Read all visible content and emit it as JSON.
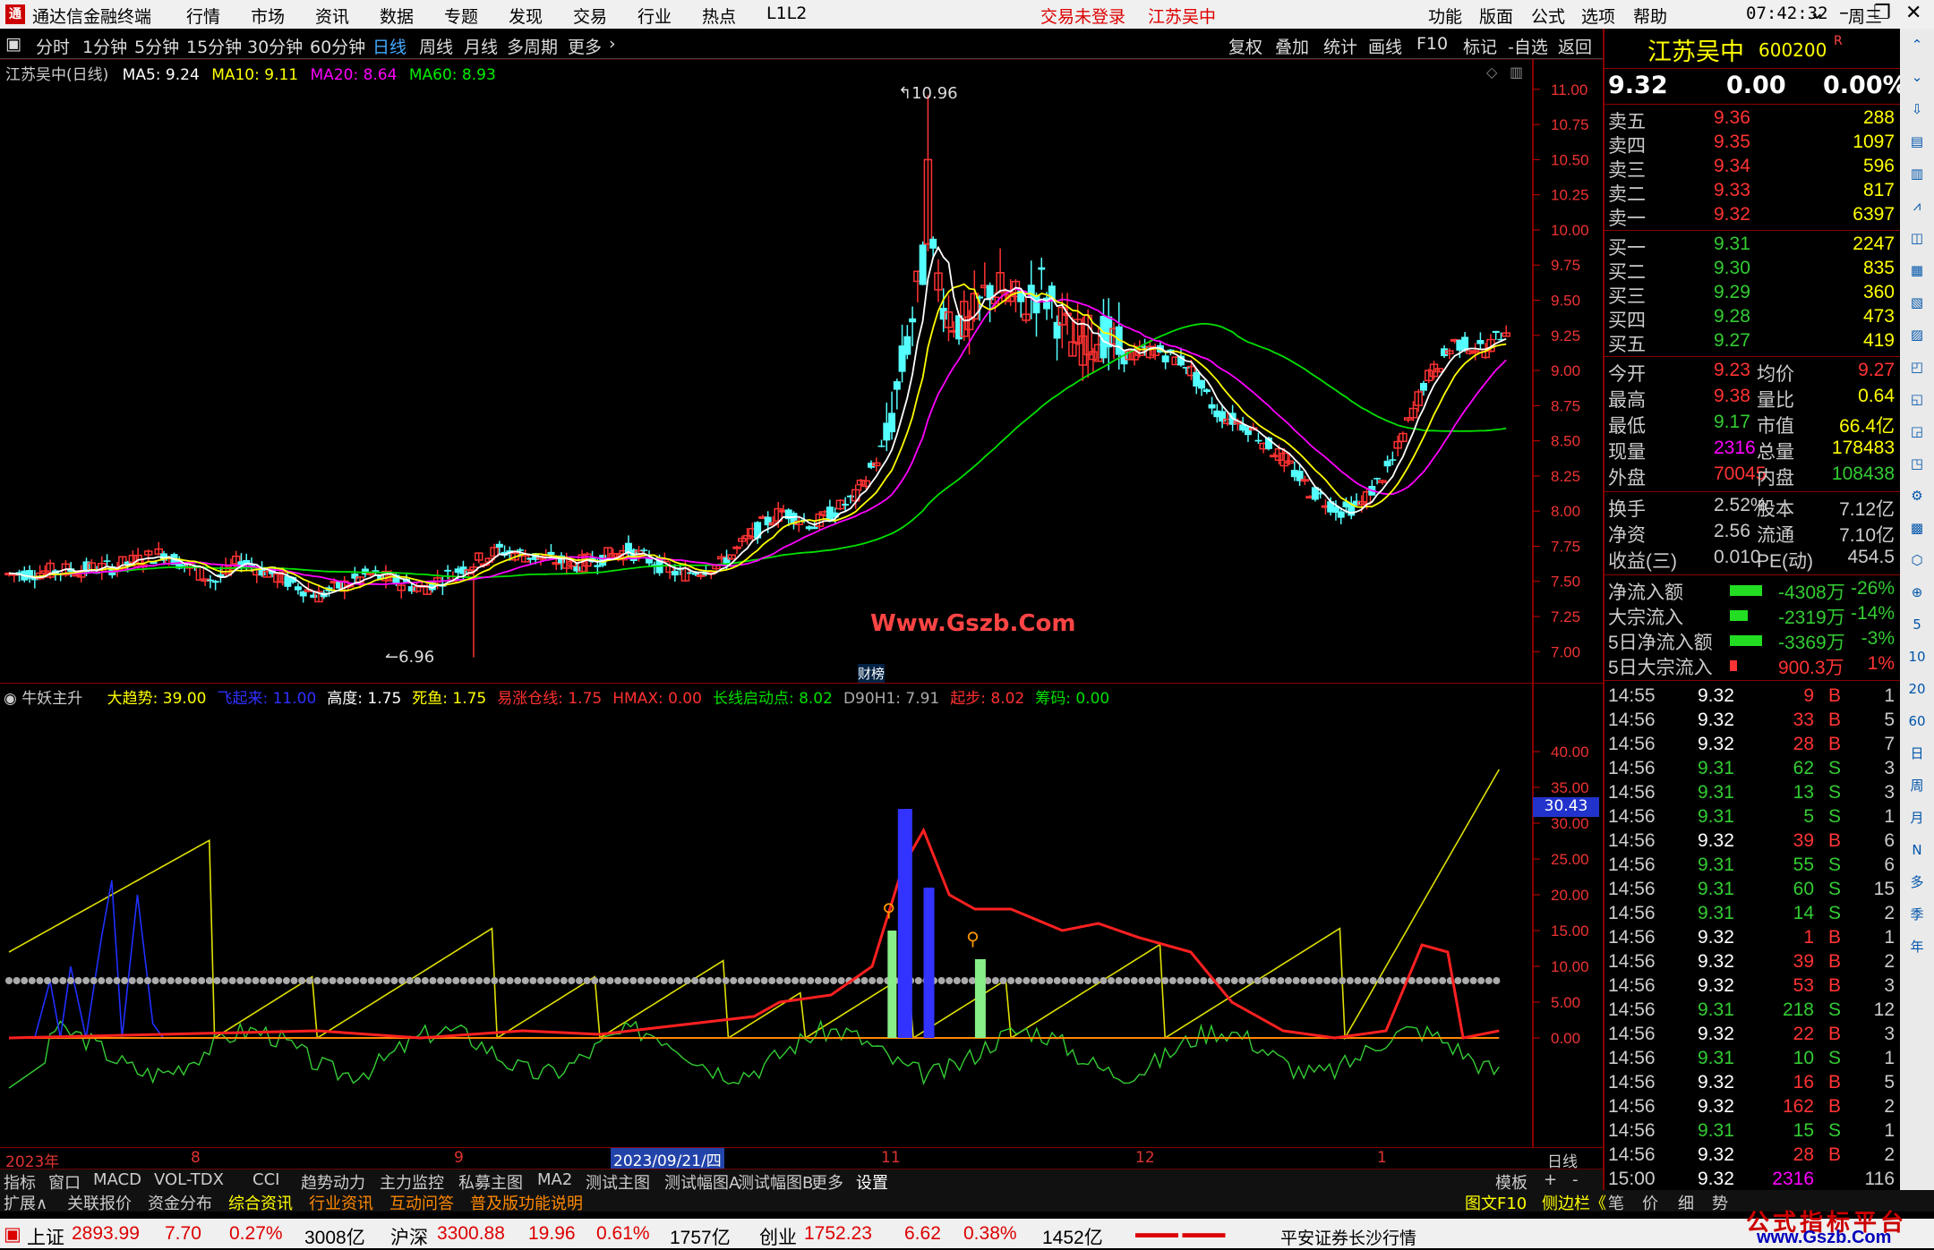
{
  "titlebar": {
    "logo": "通",
    "title": "通达信金融终端",
    "menus": [
      "行情",
      "市场",
      "资讯",
      "数据",
      "专题",
      "发现",
      "交易",
      "行业",
      "热点",
      "L1L2"
    ],
    "warn1": "交易未登录",
    "warn2": "江苏吴中",
    "rmenus": [
      "功能",
      "版面",
      "公式",
      "选项",
      "帮助"
    ],
    "time": "07:42:32",
    "weekday": "周三"
  },
  "toolbar": {
    "periods": [
      "分时",
      "1分钟",
      "5分钟",
      "15分钟",
      "30分钟",
      "60分钟",
      "日线",
      "周线",
      "月线",
      "多周期",
      "更多"
    ],
    "active": "日线",
    "actions": [
      "复权",
      "叠加",
      "统计",
      "画线",
      "F10",
      "标记",
      "-自选",
      "返回"
    ]
  },
  "main": {
    "legend_name": "江苏吴中(日线)",
    "ma5": "MA5: 9.24",
    "ma10": "MA10: 9.11",
    "ma20": "MA20: 8.64",
    "ma60": "MA60: 8.93",
    "high_label": "10.96",
    "low_label": "6.96",
    "watermark": "Www.Gszb.Com",
    "event": "财榜",
    "yticks": [
      "11.00",
      "10.75",
      "10.50",
      "10.25",
      "10.00",
      "9.75",
      "9.50",
      "9.25",
      "9.00",
      "8.75",
      "8.50",
      "8.25",
      "8.00",
      "7.75",
      "7.50",
      "7.25",
      "7.00"
    ],
    "colors": {
      "up": "#ff3232",
      "down": "#54ffff",
      "ma5": "#ffffff",
      "ma10": "#ffff00",
      "ma20": "#ff00ff",
      "ma60": "#00e000"
    }
  },
  "sub": {
    "name": "牛妖主升",
    "items": [
      {
        "label": "大趋势: 39.00",
        "color": "#ffff00"
      },
      {
        "label": "飞起来: 11.00",
        "color": "#3030ff"
      },
      {
        "label": "高度: 1.75",
        "color": "#ffffff"
      },
      {
        "label": "死鱼: 1.75",
        "color": "#ffff00"
      },
      {
        "label": "易涨仓线: 1.75",
        "color": "#ff3030"
      },
      {
        "label": "HMAX: 0.00",
        "color": "#ff3030"
      },
      {
        "label": "长线启动点: 8.02",
        "color": "#00e000"
      },
      {
        "label": "D90H1: 7.91",
        "color": "#aaaaaa"
      },
      {
        "label": "起步: 8.02",
        "color": "#ff3030"
      },
      {
        "label": "筹码: 0.00",
        "color": "#00e000"
      }
    ],
    "yticks": [
      "40.00",
      "35.00",
      "30.00",
      "25.00",
      "20.00",
      "15.00",
      "10.00",
      "5.00",
      "0.00"
    ],
    "cursor_value": "30.43",
    "xlabels": [
      "2023年",
      "8",
      "9",
      "2023/09/21/四",
      "11",
      "12",
      "1"
    ],
    "period_label": "日线"
  },
  "chart_data": [
    {
      "type": "line",
      "title": "江苏吴中(日线)",
      "ylim": [
        6.9,
        11.05
      ],
      "series": [
        {
          "name": "MA5",
          "values": [
            9.24
          ]
        },
        {
          "name": "MA10",
          "values": [
            9.11
          ]
        },
        {
          "name": "MA20",
          "values": [
            8.64
          ]
        },
        {
          "name": "MA60",
          "values": [
            8.93
          ]
        }
      ],
      "annotations": [
        "10.96",
        "6.96"
      ]
    },
    {
      "type": "line",
      "title": "牛妖主升",
      "ylim": [
        -8,
        42
      ],
      "series": [
        {
          "name": "大趋势",
          "values": [
            39.0
          ]
        },
        {
          "name": "飞起来",
          "values": [
            11.0
          ]
        }
      ]
    }
  ],
  "quote": {
    "name": "江苏吴中",
    "code": "600200",
    "r": "R",
    "price": "9.32",
    "change": "0.00",
    "pct": "0.00%",
    "asks": [
      {
        "l": "卖五",
        "p": "9.36",
        "v": "288"
      },
      {
        "l": "卖四",
        "p": "9.35",
        "v": "1097"
      },
      {
        "l": "卖三",
        "p": "9.34",
        "v": "596"
      },
      {
        "l": "卖二",
        "p": "9.33",
        "v": "817"
      },
      {
        "l": "卖一",
        "p": "9.32",
        "v": "6397"
      }
    ],
    "bids": [
      {
        "l": "买一",
        "p": "9.31",
        "v": "2247"
      },
      {
        "l": "买二",
        "p": "9.30",
        "v": "835"
      },
      {
        "l": "买三",
        "p": "9.29",
        "v": "360"
      },
      {
        "l": "买四",
        "p": "9.28",
        "v": "473"
      },
      {
        "l": "买五",
        "p": "9.27",
        "v": "419"
      }
    ],
    "stats": [
      {
        "a": "今开",
        "av": "9.23",
        "b": "均价",
        "bv": "9.27"
      },
      {
        "a": "最高",
        "av": "9.38",
        "b": "量比",
        "bv": "0.64"
      },
      {
        "a": "最低",
        "av": "9.17",
        "b": "市值",
        "bv": "66.4亿"
      },
      {
        "a": "现量",
        "av": "2316",
        "b": "总量",
        "bv": "178483"
      },
      {
        "a": "外盘",
        "av": "70045",
        "b": "内盘",
        "bv": "108438"
      }
    ],
    "stats2": [
      {
        "a": "换手",
        "av": "2.52%",
        "b": "股本",
        "bv": "7.12亿"
      },
      {
        "a": "净资",
        "av": "2.56",
        "b": "流通",
        "bv": "7.10亿"
      },
      {
        "a": "收益(三)",
        "av": "0.010",
        "b": "PE(动)",
        "bv": "454.5"
      }
    ],
    "flows": [
      {
        "l": "净流入额",
        "v": "-4308万",
        "p": "-26%"
      },
      {
        "l": "大宗流入",
        "v": "-2319万",
        "p": "-14%"
      },
      {
        "l": "5日净流入额",
        "v": "-3369万",
        "p": "-3%"
      },
      {
        "l": "5日大宗流入",
        "v": "900.3万",
        "p": "1%"
      }
    ],
    "ticks": [
      [
        "14:55",
        "9.32",
        "9",
        "B",
        "1"
      ],
      [
        "14:56",
        "9.32",
        "33",
        "B",
        "5"
      ],
      [
        "14:56",
        "9.32",
        "28",
        "B",
        "7"
      ],
      [
        "14:56",
        "9.31",
        "62",
        "S",
        "3"
      ],
      [
        "14:56",
        "9.31",
        "13",
        "S",
        "3"
      ],
      [
        "14:56",
        "9.31",
        "5",
        "S",
        "1"
      ],
      [
        "14:56",
        "9.32",
        "39",
        "B",
        "6"
      ],
      [
        "14:56",
        "9.31",
        "55",
        "S",
        "6"
      ],
      [
        "14:56",
        "9.31",
        "60",
        "S",
        "15"
      ],
      [
        "14:56",
        "9.31",
        "14",
        "S",
        "2"
      ],
      [
        "14:56",
        "9.32",
        "1",
        "B",
        "1"
      ],
      [
        "14:56",
        "9.32",
        "39",
        "B",
        "2"
      ],
      [
        "14:56",
        "9.32",
        "53",
        "B",
        "3"
      ],
      [
        "14:56",
        "9.31",
        "218",
        "S",
        "12"
      ],
      [
        "14:56",
        "9.32",
        "22",
        "B",
        "3"
      ],
      [
        "14:56",
        "9.31",
        "10",
        "S",
        "1"
      ],
      [
        "14:56",
        "9.32",
        "16",
        "B",
        "5"
      ],
      [
        "14:56",
        "9.32",
        "162",
        "B",
        "2"
      ],
      [
        "14:56",
        "9.31",
        "15",
        "S",
        "1"
      ],
      [
        "14:56",
        "9.32",
        "28",
        "B",
        "2"
      ],
      [
        "15:00",
        "9.32",
        "2316",
        "",
        "116"
      ]
    ]
  },
  "sideicons": [
    "5",
    "10",
    "20",
    "60",
    "日",
    "周",
    "月",
    "N",
    "多",
    "季",
    "年"
  ],
  "tabs1": [
    "指标",
    "窗口",
    "MACD",
    "VOL-TDX",
    "CCI",
    "趋势动力",
    "主力监控",
    "私募主图",
    "MA2",
    "测试主图",
    "测试幅图A",
    "测试幅图B",
    "更多",
    "设置"
  ],
  "tabs1_right": [
    "模板",
    "+",
    "-"
  ],
  "tabs2": [
    "扩展∧",
    "关联报价",
    "资金分布",
    "综合资讯",
    "行业资讯",
    "互动问答",
    "普及版功能说明"
  ],
  "tabs2_right": [
    "图文F10",
    "侧边栏《",
    "笔",
    "价",
    "细",
    "势"
  ],
  "status": {
    "sh": {
      "n": "上证",
      "p": "2893.99",
      "c": "7.70",
      "pc": "0.27%",
      "v": "3008亿"
    },
    "sz": {
      "n": "沪深",
      "p": "3300.88",
      "c": "19.96",
      "pc": "0.61%",
      "v": "1757亿"
    },
    "cy": {
      "n": "创业",
      "p": "1752.23",
      "c": "6.62",
      "pc": "0.38%",
      "v": "1452亿"
    },
    "broker": "平安证券长沙行情",
    "brand": "公式指标平台",
    "brand_url": "www.Gszb.Com"
  }
}
